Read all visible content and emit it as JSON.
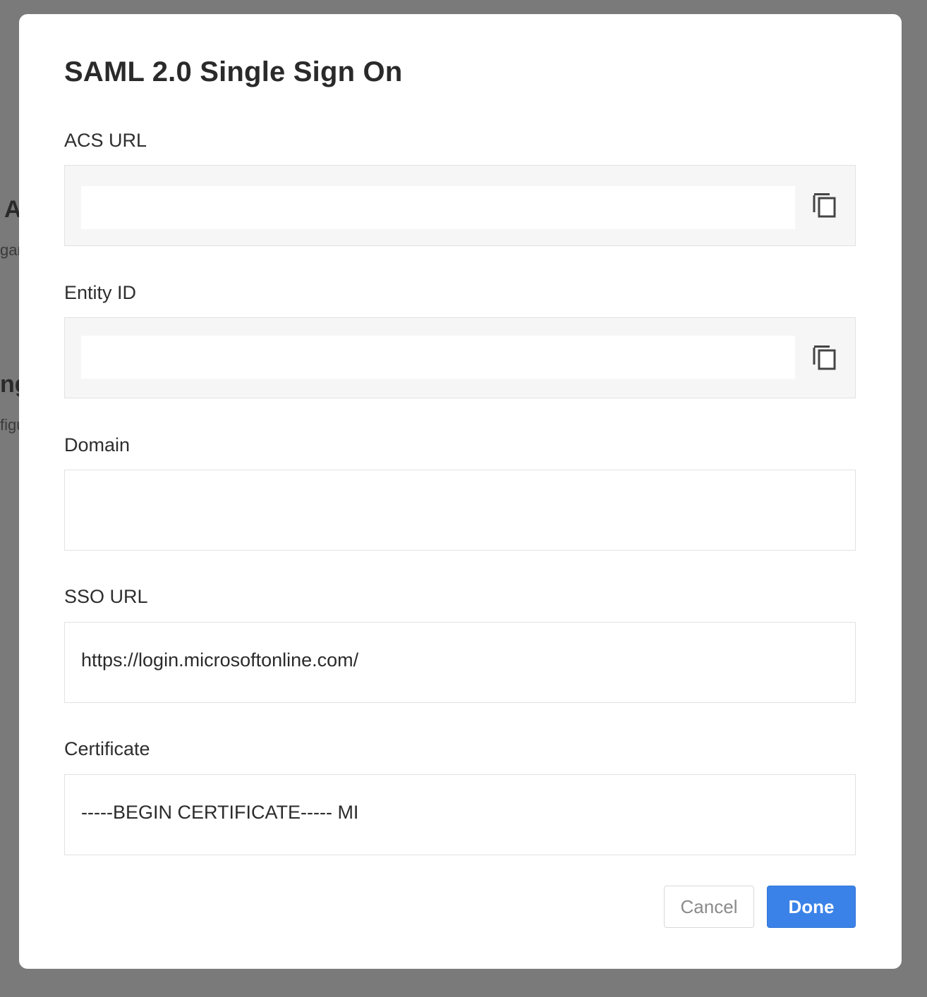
{
  "background": {
    "fragments": [
      "A",
      "gar",
      "ng",
      "figu"
    ]
  },
  "modal": {
    "title": "SAML 2.0 Single Sign On",
    "fields": {
      "acs_url": {
        "label": "ACS URL",
        "value": ""
      },
      "entity_id": {
        "label": "Entity ID",
        "value": ""
      },
      "domain": {
        "label": "Domain",
        "value": ""
      },
      "sso_url": {
        "label": "SSO URL",
        "value": "https://login.microsoftonline.com/"
      },
      "certificate": {
        "label": "Certificate",
        "value": "-----BEGIN CERTIFICATE----- MI"
      }
    },
    "buttons": {
      "cancel": "Cancel",
      "done": "Done"
    }
  },
  "colors": {
    "primary": "#3b82e8",
    "overlay": "#7a7a7a",
    "readonly_bg": "#f6f6f6"
  },
  "icons": {
    "copy": "copy-icon"
  }
}
